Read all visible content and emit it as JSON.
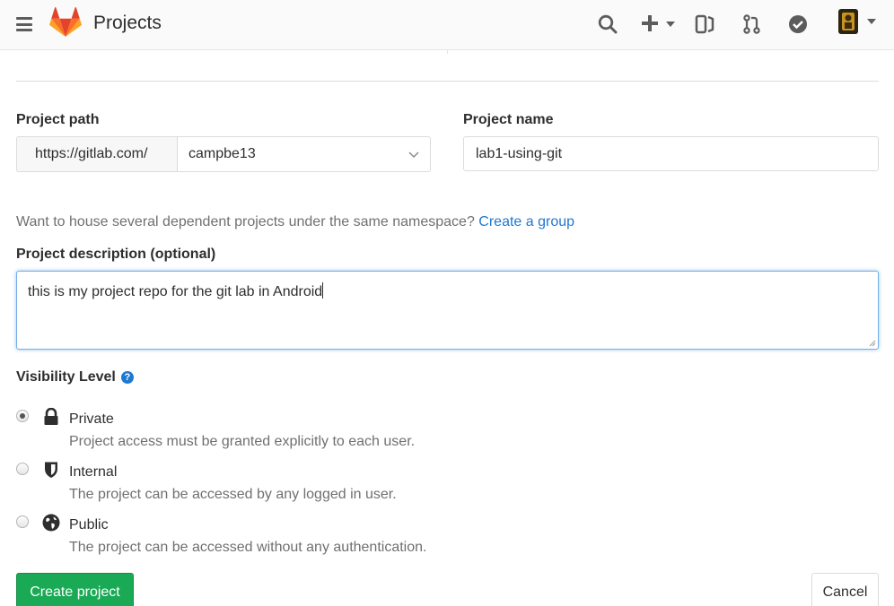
{
  "header": {
    "title": "Projects",
    "icons": [
      "menu-icon",
      "gitlab-logo",
      "search-icon",
      "plus-icon",
      "issues-icon",
      "merge-request-icon",
      "todo-icon",
      "avatar"
    ]
  },
  "form": {
    "project_path_label": "Project path",
    "path_prefix": "https://gitlab.com/",
    "namespace_value": "campbe13",
    "project_name_label": "Project name",
    "project_name_value": "lab1-using-git",
    "group_help_text": "Want to house several dependent projects under the same namespace?",
    "group_help_link": "Create a group",
    "description_label": "Project description (optional)",
    "description_value": "this is my project repo for the git lab in Android",
    "visibility_label": "Visibility Level",
    "visibility_help_glyph": "?",
    "visibility_options": [
      {
        "title": "Private",
        "description": "Project access must be granted explicitly to each user.",
        "icon": "lock-icon",
        "checked": true
      },
      {
        "title": "Internal",
        "description": "The project can be accessed by any logged in user.",
        "icon": "shield-icon",
        "checked": false
      },
      {
        "title": "Public",
        "description": "The project can be accessed without any authentication.",
        "icon": "globe-icon",
        "checked": false
      }
    ],
    "create_button": "Create project",
    "cancel_button": "Cancel"
  },
  "colors": {
    "primary_green": "#1aaa55",
    "link_blue": "#1f78d1",
    "focus_border": "#73afea",
    "muted_text": "#707070"
  }
}
